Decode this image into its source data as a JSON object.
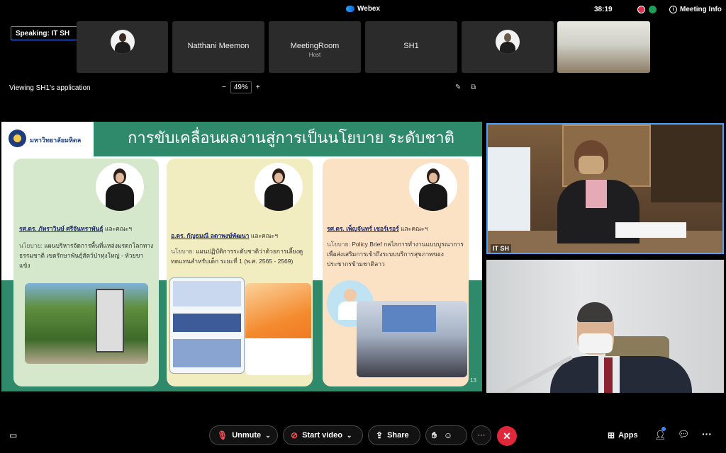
{
  "topbar": {
    "app_title": "Webex",
    "timer": "38:19",
    "meeting_info": "Meeting Info"
  },
  "speaking": "Speaking:  IT SH",
  "participants": [
    {
      "name": ""
    },
    {
      "name": "Natthani Meemon"
    },
    {
      "name": "MeetingRoom",
      "role": "Host"
    },
    {
      "name": "SH1"
    },
    {
      "name": ""
    },
    {
      "name": ""
    }
  ],
  "viewing": "Viewing SH1's application",
  "zoom": {
    "minus": "−",
    "value": "49%",
    "plus": "+"
  },
  "slide": {
    "university": "มหาวิทยาลัยมหิดล",
    "title": "การขับเคลื่อนผลงานสู่การเป็นนโยบาย ระดับชาติ",
    "page": "13",
    "cards": [
      {
        "author": "รศ.ดร. ภัทราวินษ์ ศรีจันทราพันธุ์",
        "etc": " และคณะฯ",
        "policy_label": "นโยบาย:",
        "policy": " แผนบริหารจัดการพื้นที่แหล่งมรดกโลกทางธรรมชาติ เขตรักษาพันธุ์สัตว์ป่าทุ่งใหญ่ - ห้วยขาแข้ง"
      },
      {
        "author": "อ.ดร. กัญธมณี ลดาพงษ์พัฒนา",
        "etc": " และคณะฯ",
        "policy_label": "นโยบาย:",
        "policy": " แผนปฏิบัติการระดับชาติว่าด้วยการเลี้ยงดูทดแทนสำหรับเด็ก ระยะที่ 1 (พ.ศ. 2565 - 2569)"
      },
      {
        "author": "รศ.ดร. เพ็ญจันทร์ เชอร์เรอร์",
        "etc": " และคณะฯ",
        "policy_label": "นโยบาย:",
        "policy": " Policy Brief กลไกการทำงานแบบบูรณาการเพื่อส่งเสริมการเข้าถึงระบบบริการสุขภาพของประชากรข้ามชาติลาว"
      }
    ]
  },
  "video_label": "IT SH",
  "bottombar": {
    "unmute": "Unmute",
    "start_video": "Start video",
    "share": "Share",
    "apps": "Apps",
    "more": "···"
  }
}
